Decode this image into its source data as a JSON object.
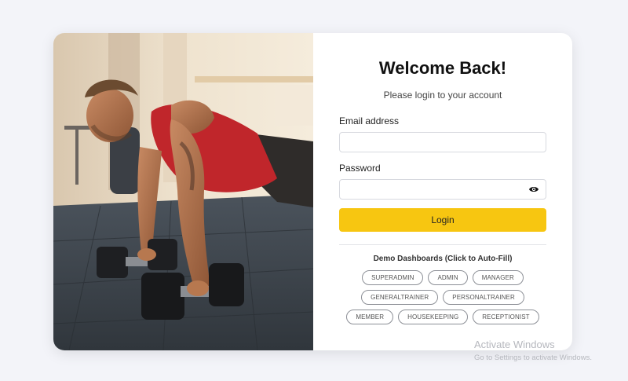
{
  "login": {
    "title": "Welcome Back!",
    "subtitle": "Please login to your account",
    "email_label": "Email address",
    "email_value": "",
    "password_label": "Password",
    "password_value": "",
    "login_label": "Login"
  },
  "demo": {
    "heading": "Demo Dashboards (Click to Auto-Fill)",
    "roles": [
      [
        "SUPERADMIN",
        "ADMIN",
        "MANAGER"
      ],
      [
        "GENERALTRAINER",
        "PERSONALTRAINER"
      ],
      [
        "MEMBER",
        "HOUSEKEEPING",
        "RECEPTIONIST"
      ]
    ]
  },
  "hero_image": {
    "description_icon": "gym-pushup-photo"
  },
  "icons": {
    "password_toggle": "eye-icon"
  },
  "colors": {
    "page_background": "#f3f4f9",
    "accent": "#f7c611"
  },
  "watermark": {
    "title": "Activate Windows",
    "subtitle": "Go to Settings to activate Windows."
  }
}
